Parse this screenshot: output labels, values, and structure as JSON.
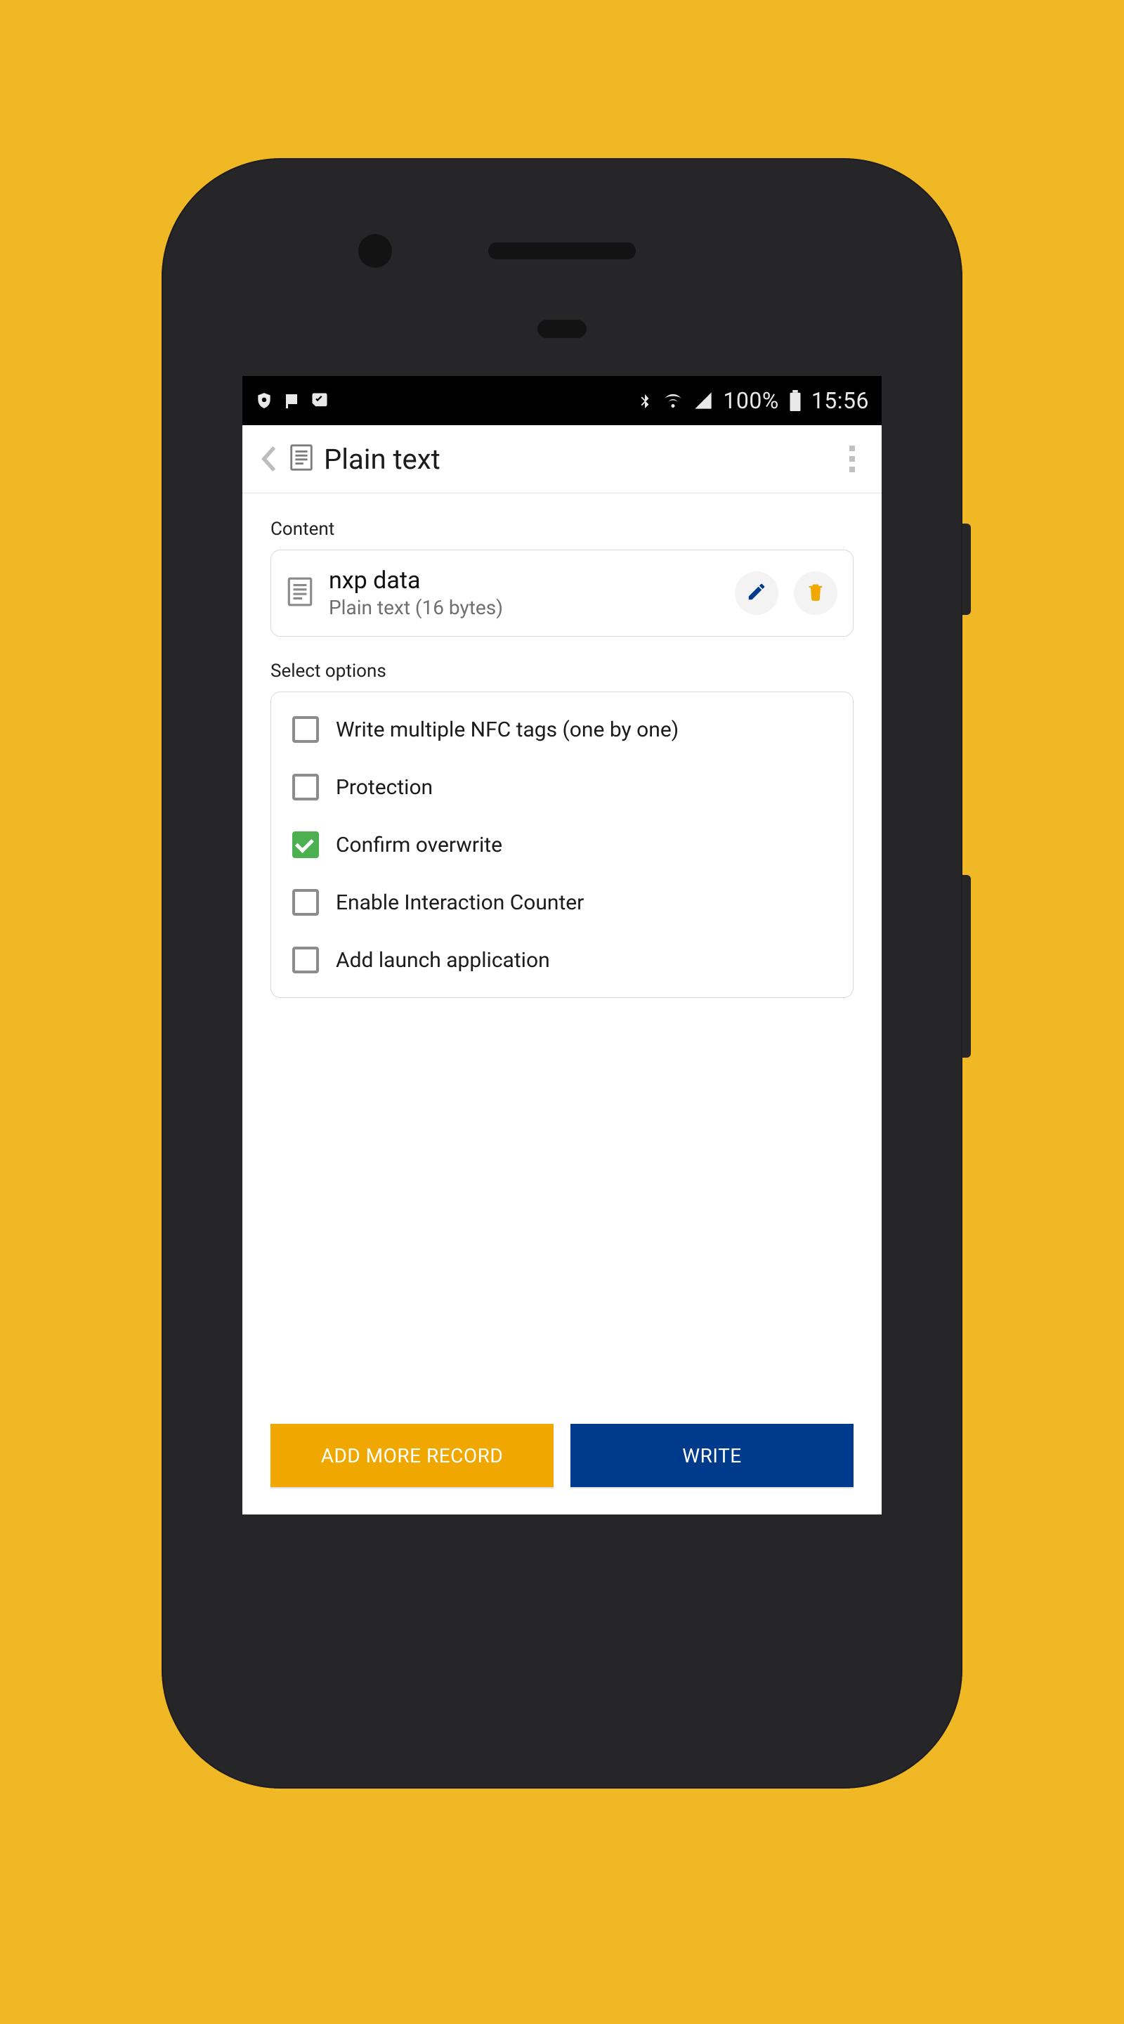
{
  "status_bar": {
    "battery_pct": "100%",
    "clock": "15:56",
    "icons_left": [
      "shield-icon",
      "flag-icon",
      "download-done-icon"
    ],
    "icons_right": [
      "bluetooth-icon",
      "wifi-icon",
      "signal-icon",
      "battery-icon"
    ]
  },
  "app_bar": {
    "title": "Plain text"
  },
  "content_section": {
    "label": "Content",
    "record": {
      "title": "nxp  data",
      "subtitle": "Plain text (16 bytes)"
    }
  },
  "options_section": {
    "label": "Select options",
    "items": [
      {
        "id": "multi-tags",
        "label": "Write multiple NFC tags (one by one)",
        "checked": false
      },
      {
        "id": "protection",
        "label": "Protection",
        "checked": false
      },
      {
        "id": "confirm-ow",
        "label": "Confirm overwrite",
        "checked": true
      },
      {
        "id": "interaction",
        "label": "Enable Interaction Counter",
        "checked": false
      },
      {
        "id": "launch-app",
        "label": "Add launch application",
        "checked": false
      }
    ]
  },
  "buttons": {
    "add_more": "ADD MORE RECORD",
    "write": "WRITE"
  },
  "colors": {
    "accent_blue": "#003a8c",
    "accent_amber": "#f0a800",
    "check_green": "#4caf50"
  }
}
